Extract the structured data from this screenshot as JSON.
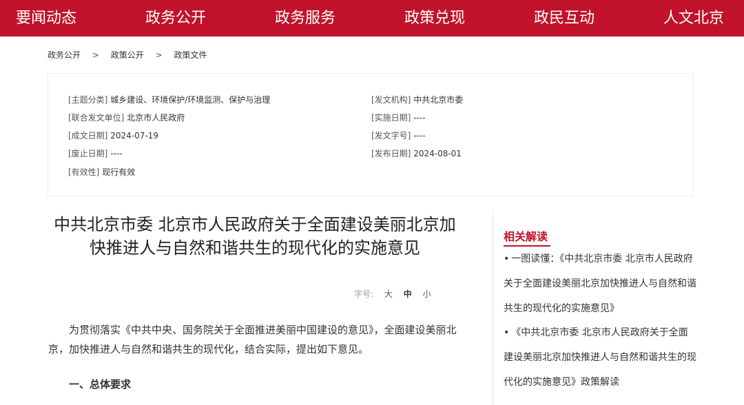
{
  "nav": {
    "items": [
      "要闻动态",
      "政务公开",
      "政务服务",
      "政策兑现",
      "政民互动",
      "人文北京"
    ]
  },
  "breadcrumb": [
    "政务公开",
    "政策公开",
    "政策文件"
  ],
  "breadcrumb_sep": ">",
  "meta": {
    "topic": {
      "label": "[主题分类]",
      "value": "城乡建设、环境保护/环境监测、保护与治理"
    },
    "issuer": {
      "label": "[发文机构]",
      "value": "中共北京市委"
    },
    "joint": {
      "label": "[联合发文单位]",
      "value": "北京市人民政府"
    },
    "effective": {
      "label": "[实施日期]",
      "value": "----"
    },
    "written": {
      "label": "[成文日期]",
      "value": "2024-07-19"
    },
    "docno": {
      "label": "[发文字号]",
      "value": "----"
    },
    "abolished": {
      "label": "[废止日期]",
      "value": "----"
    },
    "published": {
      "label": "[发布日期]",
      "value": "2024-08-01"
    },
    "validity": {
      "label": "[有效性]",
      "value": "现行有效"
    }
  },
  "article": {
    "title": "中共北京市委 北京市人民政府关于全面建设美丽北京加快推进人与自然和谐共生的现代化的实施意见",
    "font_size_label": "字号:",
    "font_sizes": [
      "大",
      "中",
      "小"
    ],
    "intro": "为贯彻落实《中共中央、国务院关于全面推进美丽中国建设的意见》，全面建设美丽北京，加快推进人与自然和谐共生的现代化，结合实际，提出如下意见。",
    "section1": "一、总体要求"
  },
  "related": {
    "title": "相关解读",
    "items": [
      "一图读懂：《中共北京市委 北京市人民政府关于全面建设美丽北京加快推进人与自然和谐共生的现代化的实施意见》",
      "《中共北京市委 北京市人民政府关于全面建设美丽北京加快推进人与自然和谐共生的现代化的实施意见》政策解读"
    ]
  }
}
